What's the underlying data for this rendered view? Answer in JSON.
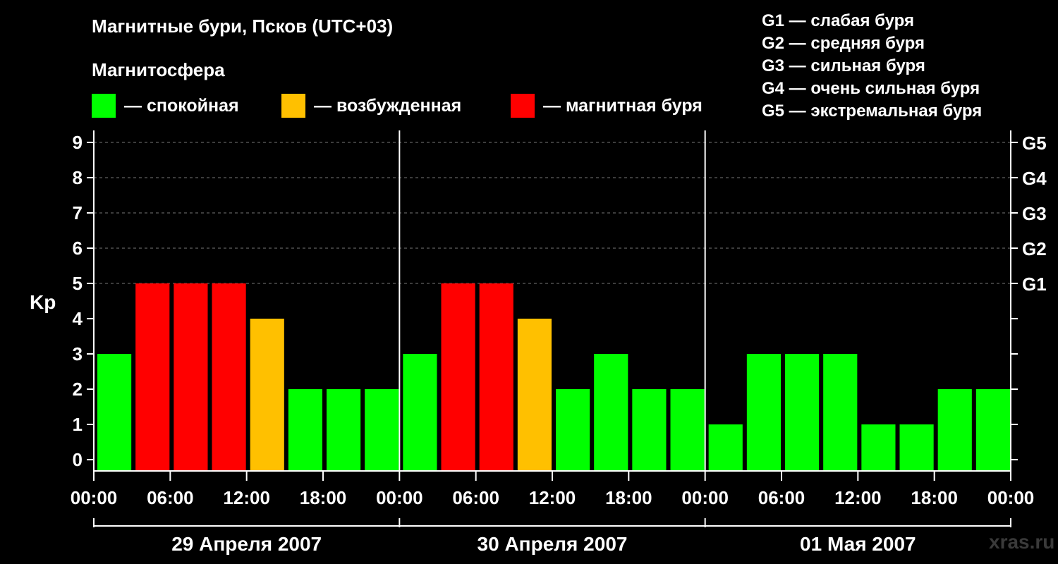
{
  "title": "Магнитные бури, Псков (UTC+03)",
  "subtitle": "Магнитосфера",
  "legend": [
    {
      "label": "— спокойная",
      "color": "#00ff00"
    },
    {
      "label": "— возбужденная",
      "color": "#ffc000"
    },
    {
      "label": "— магнитная буря",
      "color": "#ff0000"
    }
  ],
  "g_scale_legend": [
    "G1 — слабая буря",
    "G2 — средняя буря",
    "G3 — сильная буря",
    "G4 — очень сильная буря",
    "G5 — экстремальная буря"
  ],
  "watermark": "xras.ru",
  "chart_data": {
    "type": "bar",
    "ylabel": "Kp",
    "ylim": [
      0,
      9
    ],
    "yticks": [
      "0",
      "1",
      "2",
      "3",
      "4",
      "5",
      "6",
      "7",
      "8",
      "9"
    ],
    "right_axis_labels": [
      {
        "value": 5,
        "label": "G1"
      },
      {
        "value": 6,
        "label": "G2"
      },
      {
        "value": 7,
        "label": "G3"
      },
      {
        "value": 8,
        "label": "G4"
      },
      {
        "value": 9,
        "label": "G5"
      }
    ],
    "grid": "dashed horizontal at 5-9",
    "xticks": [
      "00:00",
      "06:00",
      "12:00",
      "18:00",
      "00:00",
      "06:00",
      "12:00",
      "18:00",
      "00:00",
      "06:00",
      "12:00",
      "18:00",
      "00:00"
    ],
    "days": [
      "29 Апреля 2007",
      "30 Апреля 2007",
      "01 Мая 2007"
    ],
    "values": [
      3,
      5,
      5,
      5,
      4,
      2,
      2,
      2,
      3,
      5,
      5,
      4,
      2,
      3,
      2,
      2,
      1,
      3,
      3,
      3,
      1,
      1,
      2,
      2
    ],
    "colors": [
      "#00ff00",
      "#ff0000",
      "#ff0000",
      "#ff0000",
      "#ffc000",
      "#00ff00",
      "#00ff00",
      "#00ff00",
      "#00ff00",
      "#ff0000",
      "#ff0000",
      "#ffc000",
      "#00ff00",
      "#00ff00",
      "#00ff00",
      "#00ff00",
      "#00ff00",
      "#00ff00",
      "#00ff00",
      "#00ff00",
      "#00ff00",
      "#00ff00",
      "#00ff00",
      "#00ff00"
    ]
  }
}
